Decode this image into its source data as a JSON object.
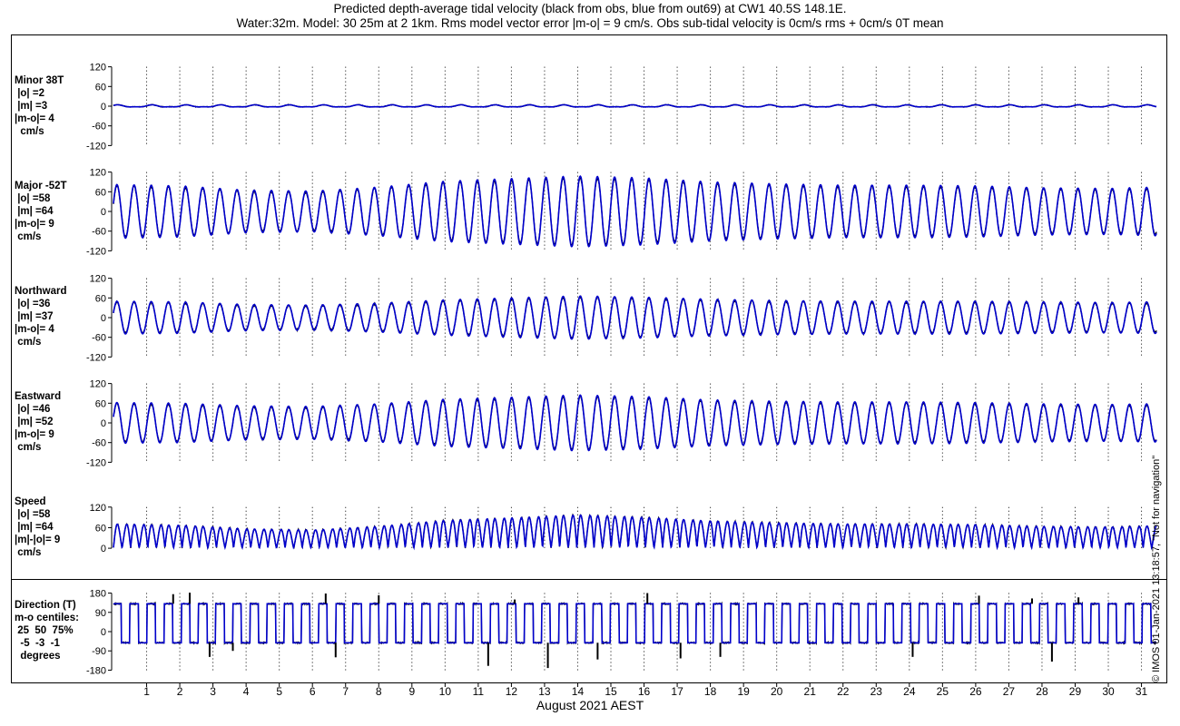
{
  "title_line1": "Predicted depth-average tidal velocity (black from obs, blue from out69) at CW1 40.5S 148.1E.",
  "title_line2": "Water:32m. Model: 30 25m at 2 1km. Rms model vector error |m-o| = 9 cm/s. Obs sub-tidal velocity is 0cm/s rms + 0cm/s 0T mean",
  "credit": "© IMOS 01-Jan-2021 13:18:57, \"Not for navigation\"",
  "colors": {
    "obs": "#000000",
    "model": "#0000cc",
    "grid": "#000000"
  },
  "chart_data": [
    {
      "type": "line",
      "name": "minor",
      "label_lines": [
        "Minor 38T",
        " |o| =2",
        " |m| =3",
        "|m-o|= 4",
        "  cm/s"
      ],
      "yticks": [
        120,
        60,
        0,
        -60,
        -120
      ],
      "ylim": [
        -130,
        130
      ],
      "amplitude": 3,
      "series": [
        {
          "name": "obs"
        },
        {
          "name": "model"
        }
      ]
    },
    {
      "type": "line",
      "name": "major",
      "label_lines": [
        "Major -52T",
        " |o| =58",
        " |m| =64",
        "|m-o|= 9",
        " cm/s"
      ],
      "yticks": [
        120,
        60,
        0,
        -60,
        -120
      ],
      "ylim": [
        -130,
        130
      ],
      "amplitude_by_day": [
        [
          0,
          82
        ],
        [
          2,
          78
        ],
        [
          4,
          65
        ],
        [
          6,
          62
        ],
        [
          8,
          74
        ],
        [
          10,
          92
        ],
        [
          12,
          100
        ],
        [
          14,
          108
        ],
        [
          16,
          102
        ],
        [
          18,
          90
        ],
        [
          20,
          84
        ],
        [
          22,
          80
        ],
        [
          24,
          80
        ],
        [
          26,
          78
        ],
        [
          28,
          72
        ],
        [
          30,
          70
        ],
        [
          31.4,
          74
        ]
      ],
      "series": [
        {
          "name": "obs"
        },
        {
          "name": "model"
        }
      ]
    },
    {
      "type": "line",
      "name": "northward",
      "label_lines": [
        "Northward",
        " |o| =36",
        " |m| =37",
        "|m-o|= 4",
        " cm/s"
      ],
      "yticks": [
        120,
        60,
        0,
        -60,
        -120
      ],
      "ylim": [
        -130,
        130
      ],
      "amplitude_by_day": [
        [
          0,
          50
        ],
        [
          2,
          48
        ],
        [
          4,
          40
        ],
        [
          6,
          38
        ],
        [
          8,
          44
        ],
        [
          10,
          54
        ],
        [
          12,
          60
        ],
        [
          14,
          66
        ],
        [
          16,
          62
        ],
        [
          18,
          56
        ],
        [
          20,
          52
        ],
        [
          22,
          50
        ],
        [
          24,
          50
        ],
        [
          26,
          50
        ],
        [
          28,
          48
        ],
        [
          30,
          46
        ],
        [
          31.4,
          48
        ]
      ],
      "series": [
        {
          "name": "obs"
        },
        {
          "name": "model"
        }
      ]
    },
    {
      "type": "line",
      "name": "eastward",
      "label_lines": [
        "Eastward",
        " |o| =46",
        " |m| =52",
        "|m-o|= 9",
        " cm/s"
      ],
      "yticks": [
        120,
        60,
        0,
        -60,
        -120
      ],
      "ylim": [
        -130,
        130
      ],
      "amplitude_by_day": [
        [
          0,
          62
        ],
        [
          2,
          60
        ],
        [
          4,
          52
        ],
        [
          6,
          50
        ],
        [
          8,
          58
        ],
        [
          10,
          72
        ],
        [
          12,
          78
        ],
        [
          14,
          85
        ],
        [
          16,
          80
        ],
        [
          18,
          70
        ],
        [
          20,
          66
        ],
        [
          22,
          64
        ],
        [
          24,
          64
        ],
        [
          26,
          62
        ],
        [
          28,
          58
        ],
        [
          30,
          56
        ],
        [
          31.4,
          58
        ]
      ],
      "series": [
        {
          "name": "obs"
        },
        {
          "name": "model"
        }
      ]
    },
    {
      "type": "line",
      "name": "speed",
      "label_lines": [
        "Speed",
        " |o| =58",
        " |m| =64",
        "|m|-|o|= 9",
        " cm/s"
      ],
      "yticks": [
        120,
        60,
        0
      ],
      "ylim": [
        -5,
        130
      ],
      "amplitude_by_day": [
        [
          0,
          80
        ],
        [
          2,
          76
        ],
        [
          4,
          64
        ],
        [
          6,
          60
        ],
        [
          8,
          72
        ],
        [
          10,
          92
        ],
        [
          12,
          100
        ],
        [
          14,
          110
        ],
        [
          16,
          102
        ],
        [
          18,
          90
        ],
        [
          20,
          84
        ],
        [
          22,
          80
        ],
        [
          24,
          80
        ],
        [
          26,
          78
        ],
        [
          28,
          72
        ],
        [
          30,
          70
        ],
        [
          31.4,
          74
        ]
      ],
      "series": [
        {
          "name": "obs"
        },
        {
          "name": "model"
        }
      ]
    },
    {
      "type": "line",
      "name": "direction",
      "label_lines": [
        "Direction (T)",
        "m-o centiles:",
        " 25  50  75%",
        "  -5  -3  -1",
        "  degrees"
      ],
      "yticks": [
        180,
        90,
        0,
        -90,
        -180
      ],
      "ylim": [
        -195,
        195
      ],
      "series": [
        {
          "name": "obs"
        },
        {
          "name": "model"
        }
      ]
    }
  ],
  "x_axis": {
    "label": "August 2021 AEST",
    "xlim_days": [
      0,
      31.45
    ],
    "ticks": [
      "1",
      "2",
      "3",
      "4",
      "5",
      "6",
      "7",
      "8",
      "9",
      "10",
      "11",
      "12",
      "13",
      "14",
      "15",
      "16",
      "17",
      "18",
      "19",
      "20",
      "21",
      "22",
      "23",
      "24",
      "25",
      "26",
      "27",
      "28",
      "29",
      "30",
      "31"
    ],
    "tick_days": [
      1,
      2,
      3,
      4,
      5,
      6,
      7,
      8,
      9,
      10,
      11,
      12,
      13,
      14,
      15,
      16,
      17,
      18,
      19,
      20,
      21,
      22,
      23,
      24,
      25,
      26,
      27,
      28,
      29,
      30,
      31
    ],
    "period_hours": 12.42,
    "grid": "dotted vertical at each day"
  }
}
